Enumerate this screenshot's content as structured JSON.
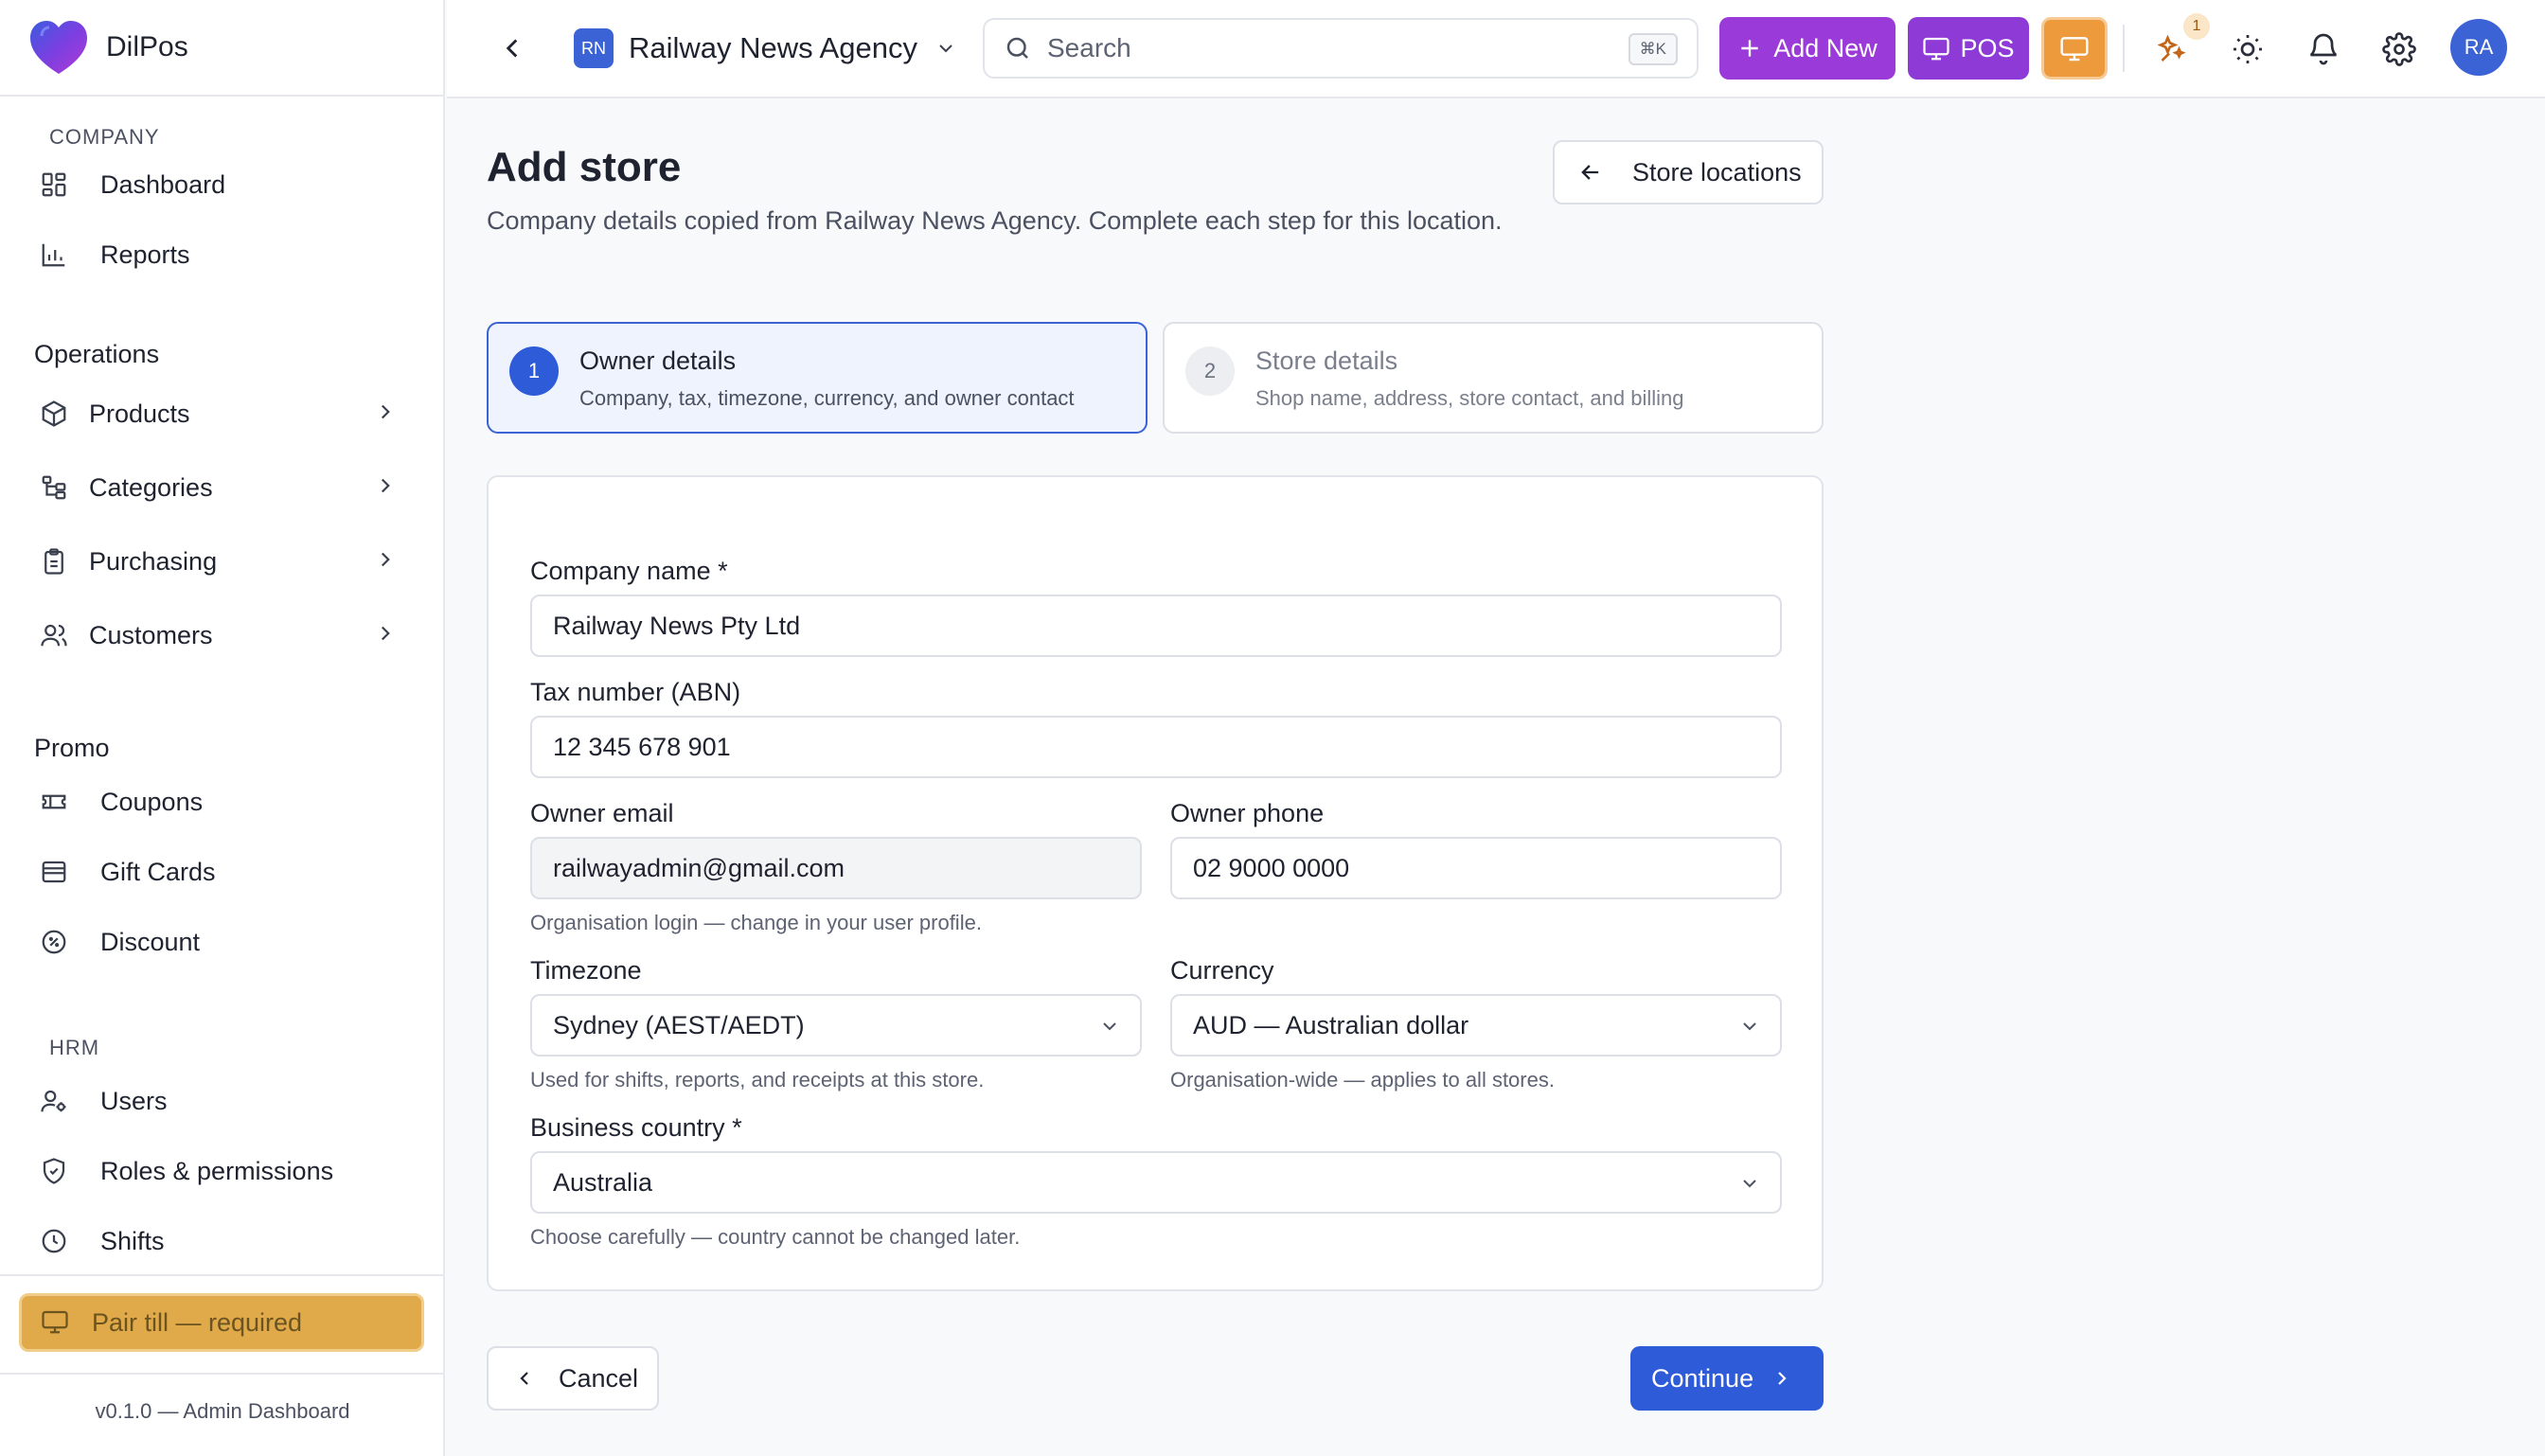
{
  "brand": {
    "name": "DilPos"
  },
  "sidebar": {
    "company_label": "COMPANY",
    "company_items": [
      {
        "label": "Dashboard",
        "icon": "dashboard-icon"
      },
      {
        "label": "Reports",
        "icon": "bar-chart-icon"
      }
    ],
    "operations_label": "Operations",
    "operations_items": [
      {
        "label": "Products",
        "icon": "box-icon"
      },
      {
        "label": "Categories",
        "icon": "hierarchy-icon"
      },
      {
        "label": "Purchasing",
        "icon": "clipboard-icon"
      },
      {
        "label": "Customers",
        "icon": "users-icon"
      }
    ],
    "promo_label": "Promo",
    "promo_items": [
      {
        "label": "Coupons",
        "icon": "ticket-icon"
      },
      {
        "label": "Gift Cards",
        "icon": "gift-card-icon"
      },
      {
        "label": "Discount",
        "icon": "discount-icon"
      }
    ],
    "hrm_label": "HRM",
    "hrm_items": [
      {
        "label": "Users",
        "icon": "user-gear-icon"
      },
      {
        "label": "Roles & permissions",
        "icon": "shield-icon"
      },
      {
        "label": "Shifts",
        "icon": "clock-icon"
      }
    ],
    "pair_till": "Pair till — required",
    "version": "v0.1.0 — Admin Dashboard"
  },
  "topbar": {
    "org_initials": "RN",
    "org_name": "Railway News Agency",
    "search_placeholder": "Search",
    "search_shortcut": "⌘K",
    "add_new_label": "Add New",
    "pos_label": "POS",
    "notification_count": "1",
    "avatar_initials": "RA"
  },
  "page": {
    "title": "Add store",
    "subtitle": "Company details copied from Railway News Agency. Complete each step for this location.",
    "store_locations_label": "Store locations",
    "steps": [
      {
        "number": "1",
        "title": "Owner details",
        "description": "Company, tax, timezone, currency, and owner contact",
        "active": true
      },
      {
        "number": "2",
        "title": "Store details",
        "description": "Shop name, address, store contact, and billing",
        "active": false
      }
    ],
    "form": {
      "company_name_label": "Company name *",
      "company_name_value": "Railway News Pty Ltd",
      "tax_number_label": "Tax number (ABN)",
      "tax_number_value": "12 345 678 901",
      "owner_email_label": "Owner email",
      "owner_email_value": "railwayadmin@gmail.com",
      "owner_email_hint": "Organisation login — change in your user profile.",
      "owner_phone_label": "Owner phone",
      "owner_phone_value": "02 9000 0000",
      "timezone_label": "Timezone",
      "timezone_value": "Sydney (AEST/AEDT)",
      "timezone_hint": "Used for shifts, reports, and receipts at this store.",
      "currency_label": "Currency",
      "currency_value": "AUD — Australian dollar",
      "currency_hint": "Organisation-wide — applies to all stores.",
      "country_label": "Business country *",
      "country_value": "Australia",
      "country_hint": "Choose carefully — country cannot be changed later."
    },
    "cancel_label": "Cancel",
    "continue_label": "Continue"
  },
  "colors": {
    "primary": "#2e5bd8",
    "add_new": "#9a3ad8",
    "pos": "#8e3ad6",
    "screen_button": "#ed9a3c",
    "pair_till": "#e0a94a"
  }
}
